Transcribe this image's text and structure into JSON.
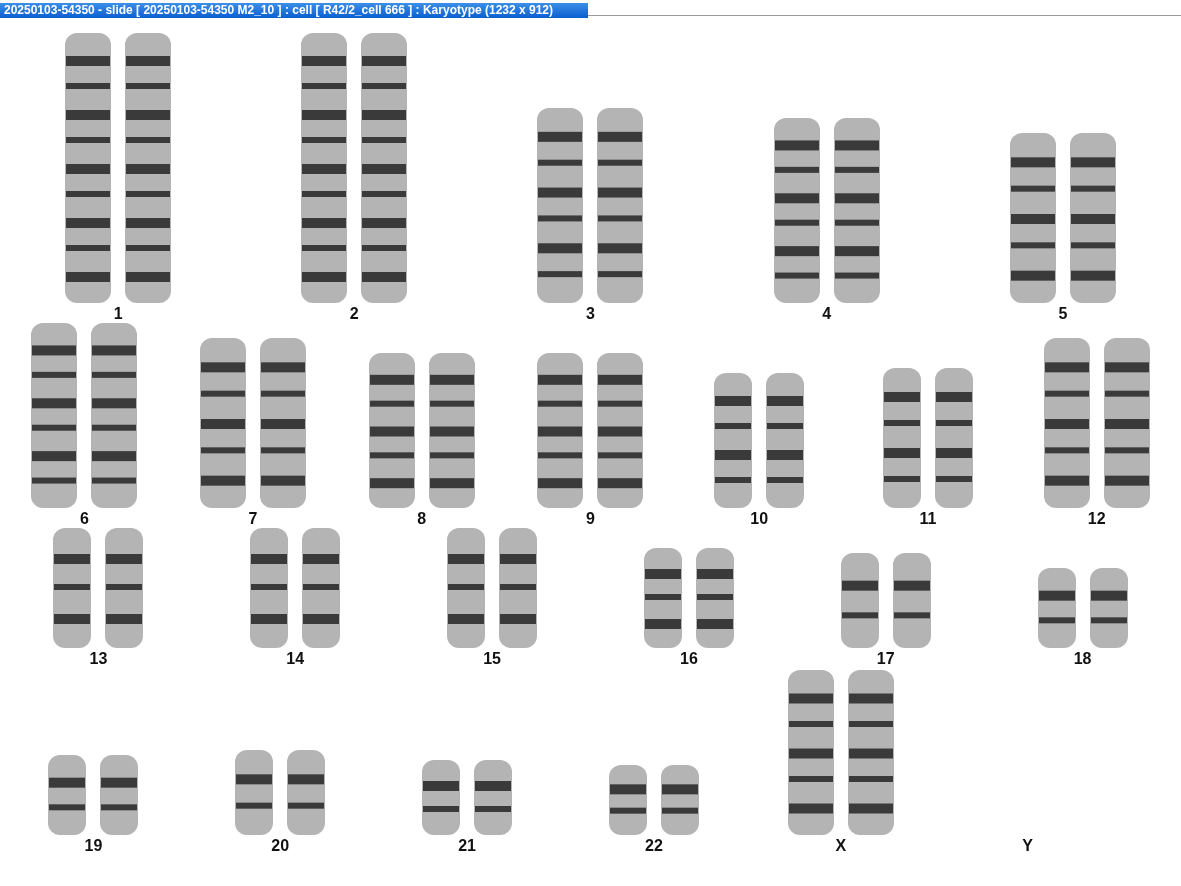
{
  "window": {
    "title": "20250103-54350 - slide [ 20250103-54350 M2_10 ] : cell [ R42/2_cell 666 ] : Karyotype  (1232 x 912)"
  },
  "rows": [
    [
      {
        "label": "1",
        "kind": "pair"
      },
      {
        "label": "2",
        "kind": "pair"
      },
      {
        "label": "3",
        "kind": "pair"
      },
      {
        "label": "4",
        "kind": "pair"
      },
      {
        "label": "5",
        "kind": "pair"
      }
    ],
    [
      {
        "label": "6",
        "kind": "pair"
      },
      {
        "label": "7",
        "kind": "pair"
      },
      {
        "label": "8",
        "kind": "pair"
      },
      {
        "label": "9",
        "kind": "pair"
      },
      {
        "label": "10",
        "kind": "pair"
      },
      {
        "label": "11",
        "kind": "pair"
      },
      {
        "label": "12",
        "kind": "pair"
      }
    ],
    [
      {
        "label": "13",
        "kind": "pair"
      },
      {
        "label": "14",
        "kind": "pair"
      },
      {
        "label": "15",
        "kind": "pair"
      },
      {
        "label": "16",
        "kind": "pair"
      },
      {
        "label": "17",
        "kind": "pair"
      },
      {
        "label": "18",
        "kind": "pair"
      }
    ],
    [
      {
        "label": "19",
        "kind": "pair"
      },
      {
        "label": "20",
        "kind": "pair"
      },
      {
        "label": "21",
        "kind": "pair"
      },
      {
        "label": "22",
        "kind": "pair"
      },
      {
        "label": "X",
        "kind": "pair"
      },
      {
        "label": "Y",
        "kind": "none"
      }
    ]
  ]
}
